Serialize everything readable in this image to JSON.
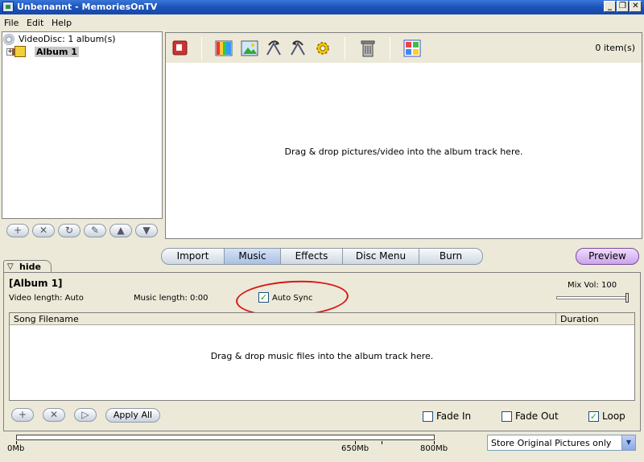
{
  "window": {
    "title": "Unbenannt - MemoriesOnTV"
  },
  "menu": [
    "File",
    "Edit",
    "Help"
  ],
  "tree": {
    "root": "VideoDisc: 1 album(s)",
    "album": "Album 1"
  },
  "album_area": {
    "item_count": "0 item(s)",
    "drop_text": "Drag & drop pictures/video into the album track here."
  },
  "tabs": [
    "Import",
    "Music",
    "Effects",
    "Disc Menu",
    "Burn"
  ],
  "active_tab": "Music",
  "preview_label": "Preview",
  "hide_label": "hide",
  "music": {
    "album_title": "[Album 1]",
    "video_length": "Video length: Auto",
    "music_length": "Music length:  0:00",
    "auto_sync_label": "Auto Sync",
    "auto_sync_checked": true,
    "mix_vol": "Mix Vol: 100",
    "mix_vol_value": 100,
    "col_song": "Song Filename",
    "col_duration": "Duration",
    "drop_text": "Drag & drop music files into the album track here.",
    "apply_all": "Apply All",
    "fade_in": "Fade In",
    "fade_in_checked": false,
    "fade_out": "Fade Out",
    "fade_out_checked": false,
    "loop": "Loop",
    "loop_checked": true
  },
  "disc": {
    "labels": [
      "0Mb",
      "650Mb",
      "800Mb"
    ],
    "store_option": "Store Original Pictures only"
  },
  "colors": {
    "titlebar": "#1c53b8",
    "annotation": "#d81818",
    "preview": "#c9a3ea"
  }
}
